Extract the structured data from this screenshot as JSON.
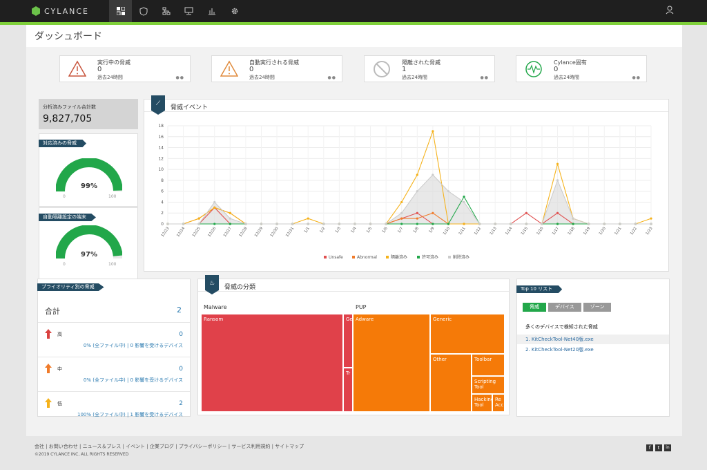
{
  "app": {
    "brand": "CYLANCE"
  },
  "nav": {
    "icons": [
      "dashboard-icon",
      "shield-icon",
      "network-icon",
      "monitor-icon",
      "bar-chart-icon",
      "gear-icon"
    ],
    "user_icon": "user-icon"
  },
  "page_title": "ダッシュボード",
  "stats": [
    {
      "title": "実行中の脅威",
      "value": "0",
      "sub": "過去24時間",
      "icon": "warning-icon",
      "color": "#c8553d"
    },
    {
      "title": "自動実行される脅威",
      "value": "0",
      "sub": "過去24時間",
      "icon": "warning-icon",
      "color": "#e08a3b"
    },
    {
      "title": "隔離された脅威",
      "value": "1",
      "sub": "過去24時間",
      "icon": "prohibited-icon",
      "color": "#bbbbbb"
    },
    {
      "title": "Cylance固有",
      "value": "0",
      "sub": "過去24時間",
      "icon": "pulse-icon",
      "color": "#22a74a"
    }
  ],
  "total_files": {
    "label": "分析済みファイル合計数",
    "value": "9,827,705"
  },
  "gauges": [
    {
      "title": "対応済みの脅威",
      "percent": 99,
      "pct_label": "99%",
      "min": "0",
      "max": "100"
    },
    {
      "title": "自動隔離設定の端末",
      "percent": 97,
      "pct_label": "97%",
      "min": "0",
      "max": "100"
    }
  ],
  "events": {
    "title": "脅威イベント",
    "chart_data": {
      "type": "line",
      "x": [
        "12/23",
        "12/24",
        "12/25",
        "12/26",
        "12/27",
        "12/28",
        "12/29",
        "12/30",
        "12/31",
        "1/1",
        "1/2",
        "1/3",
        "1/4",
        "1/5",
        "1/6",
        "1/7",
        "1/8",
        "1/9",
        "1/10",
        "1/11",
        "1/12",
        "1/13",
        "1/14",
        "1/15",
        "1/16",
        "1/17",
        "1/18",
        "1/19",
        "1/20",
        "1/21",
        "1/22",
        "1/23"
      ],
      "ylim": [
        0,
        18
      ],
      "yticks": [
        "0",
        "2",
        "4",
        "6",
        "8",
        "10",
        "12",
        "14",
        "16",
        "18"
      ],
      "series": [
        {
          "name": "Unsafe",
          "color": "#e05050",
          "values": [
            0,
            0,
            0,
            3,
            0,
            0,
            0,
            0,
            0,
            0,
            0,
            0,
            0,
            0,
            0,
            1,
            2,
            0,
            0,
            0,
            0,
            0,
            0,
            2,
            0,
            2,
            0,
            0,
            0,
            0,
            0,
            0
          ]
        },
        {
          "name": "Abnormal",
          "color": "#f07b2a",
          "values": [
            0,
            0,
            1,
            3,
            2,
            0,
            0,
            0,
            0,
            0,
            0,
            0,
            0,
            0,
            0,
            1,
            1,
            2,
            0,
            0,
            0,
            0,
            0,
            0,
            0,
            0,
            0,
            0,
            0,
            0,
            0,
            0
          ]
        },
        {
          "name": "隔離済み",
          "color": "#f5b21b",
          "values": [
            0,
            0,
            1,
            3,
            2,
            0,
            0,
            0,
            0,
            1,
            0,
            0,
            0,
            0,
            0,
            4,
            9,
            17,
            0,
            0,
            0,
            0,
            0,
            0,
            0,
            11,
            1,
            0,
            0,
            0,
            0,
            1
          ]
        },
        {
          "name": "許可済み",
          "color": "#22a74a",
          "values": [
            0,
            0,
            0,
            0,
            0,
            0,
            0,
            0,
            0,
            0,
            0,
            0,
            0,
            0,
            0,
            0,
            0,
            0,
            0,
            5,
            0,
            0,
            0,
            0,
            0,
            0,
            0,
            0,
            0,
            0,
            0,
            0
          ]
        },
        {
          "name": "削除済み",
          "color": "#cccccc",
          "values": [
            0,
            0,
            0,
            4,
            1,
            0,
            0,
            0,
            0,
            0,
            0,
            0,
            0,
            0,
            0,
            2,
            6,
            9,
            6,
            4,
            0,
            0,
            0,
            0,
            0,
            8,
            1,
            0,
            0,
            0,
            0,
            0
          ]
        }
      ]
    }
  },
  "priority": {
    "title": "プライオリティ別の脅威",
    "total_label": "合計",
    "total_value": "2",
    "rows": [
      {
        "label": "高",
        "count": "0",
        "sub": "0% (全ファイル中) | 0 影響を受けるデバイス",
        "color": "#d9413f"
      },
      {
        "label": "中",
        "count": "0",
        "sub": "0% (全ファイル中) | 0 影響を受けるデバイス",
        "color": "#f07b2a"
      },
      {
        "label": "低",
        "count": "2",
        "sub": "100% (全ファイル中) | 1 影響を受けるデバイス",
        "color": "#f5b21b"
      }
    ]
  },
  "classification": {
    "title": "脅威の分類",
    "groups": [
      {
        "label": "Malware"
      },
      {
        "label": "PUP"
      }
    ],
    "cells": [
      "Ransom",
      "Ge",
      "Tr",
      "Adware",
      "Generic",
      "Other",
      "Toolbar",
      "Scripting Tool",
      "Hacking Tool",
      "Re Acc"
    ]
  },
  "top10": {
    "title": "Top 10 リスト",
    "tabs": [
      "脅威",
      "デバイス",
      "ゾーン"
    ],
    "heading": "多くのデバイスで検知された脅威",
    "items": [
      "1. KitCheckTool-Net40版.exe",
      "2. KitCheckTool-Net20版.exe"
    ]
  },
  "footer": {
    "links": "会社 | お問い合わせ | ニュース＆プレス | イベント | 企業ブログ | プライバシーポリシー | サービス利用規約 | サイトマップ",
    "copyright": "©2019 CYLANCE INC, ALL RIGHTS RESERVED",
    "social": [
      "f",
      "t",
      "in"
    ]
  }
}
